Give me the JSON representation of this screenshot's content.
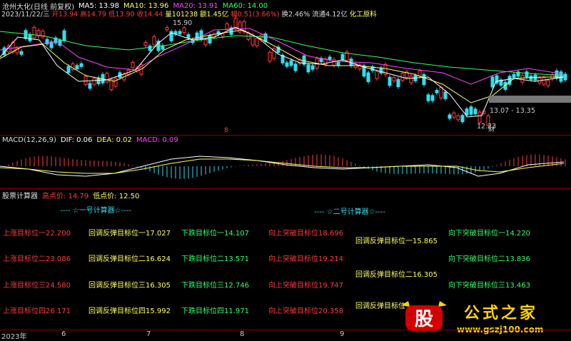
{
  "header": {
    "title": "沧州大化(日线 前复权)",
    "ma5": "MA5: 13.98",
    "ma10": "MA10: 13.96",
    "ma20": "MA20: 13.91",
    "ma60": "MA60: 14.00"
  },
  "info_line": {
    "date": "2023/11/22/三",
    "open": "开13.94",
    "high": "高14.79",
    "low": "低13.90",
    "close": "收14.44",
    "volume": "量101238",
    "amount": "额1.45亿",
    "change": "幅0.51(3.66%)",
    "turnover": "换2.46%",
    "float": "流通4.12亿",
    "sector": "化工原料"
  },
  "price_labels": {
    "high_mark": "15.90",
    "low_mark": "12.23",
    "range": "13.07 - 13.35",
    "cai": "财",
    "marker": "8"
  },
  "macd": {
    "label": "MACD(12,26,9)",
    "dif": "DIF: 0.06",
    "dea": "DEA: 0.02",
    "macd": "MACD: 0.09"
  },
  "calculator": {
    "title": "股票计算器",
    "high": "高点价: 14.79",
    "low": "低点价: 12.50",
    "section1": "---- ☆一号计算器☆----",
    "section2": "---- ☆二号计算器☆----",
    "col_up": [
      "上涨目标位一22.200",
      "上涨目标位二23.086",
      "上涨目标位三24.580",
      "上涨目标位四26.171"
    ],
    "col_rebound": [
      "回调反弹目标位一17.027",
      "回调反弹目标位二16.624",
      "回调反弹目标位三16.305",
      "回调反弹目标位四15.992"
    ],
    "col_down": [
      "下跌目标位一14.107",
      "下跌目标位二13.571",
      "下跌目标位三12.746",
      "下跌目标位四11.971"
    ],
    "col_break_up": [
      "向上突破目标位18.696",
      "向上突破目标位19.214",
      "向上突破目标位19.747",
      "向上突破目标位20.358"
    ],
    "col_rebound2": [
      "回调反弹目标位一15.865",
      "回调反弹目标位二16.305",
      "回调反弹目标位"
    ],
    "col_break_down": [
      "向下突破目标位一14.220",
      "向下突破目标位二13.836",
      "向下突破目标位三13.463"
    ]
  },
  "axis": {
    "year": "2023年",
    "months": [
      "6",
      "7",
      "8",
      "9"
    ]
  },
  "logo": {
    "mark": "股",
    "text": "公式之家",
    "url": "www.gszj100.com"
  },
  "colors": {
    "up": "#ff3b3b",
    "down": "#33ddee",
    "ma5": "#ffffff",
    "ma10": "#ffff66",
    "ma20": "#ff44ff",
    "ma60": "#33ff66",
    "grid": "#8b0000"
  }
}
